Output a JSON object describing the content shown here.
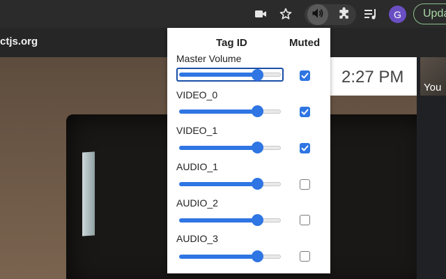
{
  "browser": {
    "site_text": "ctjs.org",
    "avatar_initial": "G",
    "update_label": "Upda"
  },
  "video": {
    "clock": "2:27  PM",
    "self_label": "You"
  },
  "popup": {
    "header_tag": "Tag ID",
    "header_muted": "Muted",
    "rows": [
      {
        "label": "Master Volume",
        "volume": 0.8,
        "muted": true
      },
      {
        "label": "VIDEO_0",
        "volume": 0.8,
        "muted": true
      },
      {
        "label": "VIDEO_1",
        "volume": 0.8,
        "muted": true
      },
      {
        "label": "AUDIO_1",
        "volume": 0.8,
        "muted": false
      },
      {
        "label": "AUDIO_2",
        "volume": 0.8,
        "muted": false
      },
      {
        "label": "AUDIO_3",
        "volume": 0.8,
        "muted": false
      }
    ]
  },
  "icons": {
    "camera": "camera-icon",
    "star": "bookmark-star-icon",
    "speaker": "speaker-icon",
    "puzzle": "extensions-puzzle-icon",
    "media": "media-queue-icon"
  },
  "colors": {
    "accent": "#2f75e3",
    "avatar": "#6a4fc3",
    "update": "#a9d8a4"
  }
}
